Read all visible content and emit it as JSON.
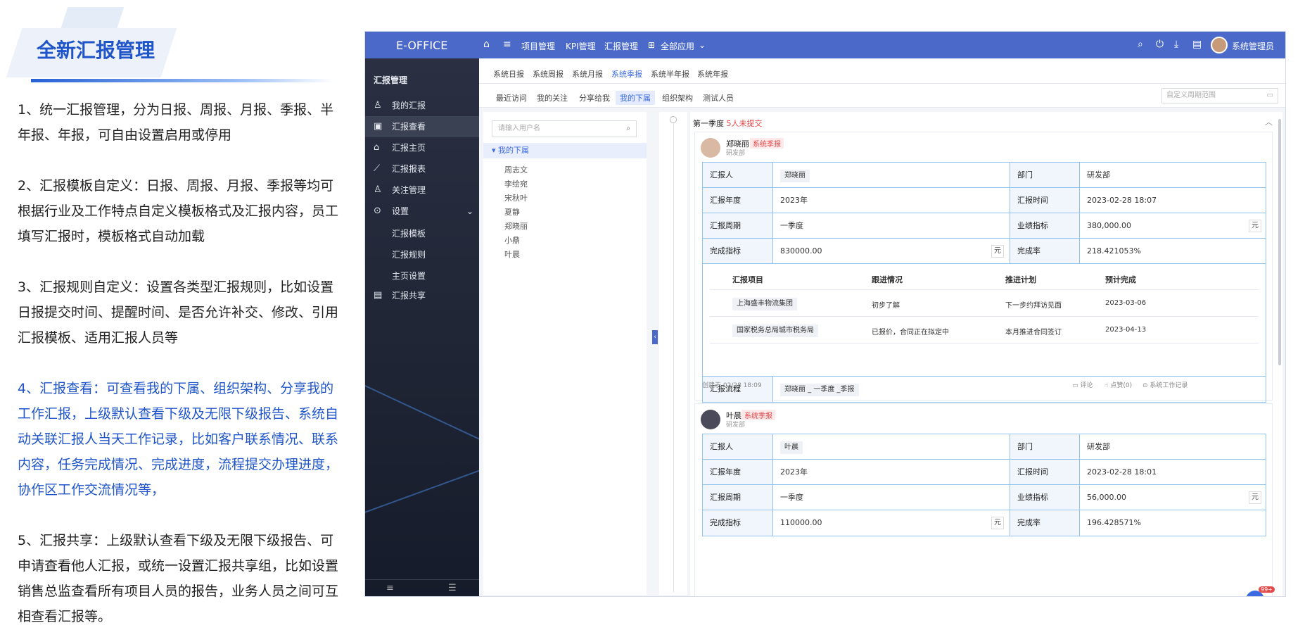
{
  "slide": {
    "title": "全新汇报管理",
    "paragraphs": [
      "1、统一汇报管理，分为日报、周报、月报、季报、半年报、年报，可自由设置启用或停用",
      "2、汇报模板自定义：日报、周报、月报、季报等均可根据行业及工作特点自定义模板格式及汇报内容，员工填写汇报时，模板格式自动加载",
      "3、汇报规则自定义：设置各类型汇报规则，比如设置日报提交时间、提醒时间、是否允许补交、修改、引用汇报模板、适用汇报人员等",
      "4、汇报查看：可查看我的下属、组织架构、分享我的工作汇报，上级默认查看下级及无限下级报告、系统自动关联汇报人当天工作记录，比如客户联系情况、联系内容，任务完成情况、完成进度，流程提交办理进度，协作区工作交流情况等，",
      "5、汇报共享：上级默认查看下级及无限下级报告、可申请查看他人汇报，或统一设置汇报共享组，比如设置销售总监查看所有项目人员的报告，业务人员之间可互相查看汇报等。"
    ]
  },
  "app": {
    "logo": "E-OFFICE",
    "nav": [
      "项目管理",
      "KPI管理",
      "汇报管理",
      "全部应用"
    ],
    "user": "系统管理员",
    "sidebar": {
      "header": "汇报管理",
      "items": [
        "我的汇报",
        "汇报查看",
        "汇报主页",
        "汇报报表",
        "关注管理",
        "设置"
      ],
      "settings_sub": [
        "汇报模板",
        "汇报规则",
        "主页设置"
      ],
      "share": "汇报共享"
    },
    "tabs1": [
      "系统日报",
      "系统周报",
      "系统月报",
      "系统季报",
      "系统半年报",
      "系统年报"
    ],
    "tabs2": [
      "最近访问",
      "我的关注",
      "分享给我",
      "我的下属",
      "组织架构",
      "测试人员"
    ],
    "range_placeholder": "自定义周期范围",
    "search_placeholder": "请输入用户名",
    "tree_root": "我的下属",
    "tree_nodes": [
      "周志文",
      "李绘宛",
      "宋秋叶",
      "夏静",
      "郑晓丽",
      "小鼎",
      "叶晨"
    ],
    "quarter_label": "第一季度",
    "quarter_missing": "5人未提交",
    "card1": {
      "name": "郑晓丽",
      "dept": "研发部",
      "tag": "系统季报",
      "labels": {
        "reporter": "汇报人",
        "dept": "部门",
        "year": "汇报年度",
        "time": "汇报时间",
        "period": "汇报周期",
        "target": "业绩指标",
        "done": "完成指标",
        "rate": "完成率",
        "flow": "汇报流程"
      },
      "reporter": "郑晓丽",
      "dept_val": "研发部",
      "year": "2023年",
      "time": "2023-02-28 18:07",
      "period": "一季度",
      "target": "380,000.00",
      "unit": "元",
      "done": "830000.00",
      "rate": "218.421053%",
      "sub_headers": [
        "汇报项目",
        "跟进情况",
        "推进计划",
        "预计完成"
      ],
      "sub_rows": [
        [
          "上海盛丰物流集团",
          "初步了解",
          "下一步约拜访见面",
          "2023-03-06"
        ],
        [
          "国家税务总局城市税务局",
          "已报价，合同正在拟定中",
          "本月推进合同签订",
          "2023-04-13"
        ]
      ],
      "flow": "郑晓丽 _ 一季度 _季报",
      "created": "创建于 02/28 18:09",
      "actions": [
        "评论",
        "点赞(0)",
        "系统工作记录"
      ]
    },
    "card2": {
      "name": "叶晨",
      "dept": "研发部",
      "tag": "系统季报",
      "reporter": "叶晨",
      "dept_val": "研发部",
      "year": "2023年",
      "time": "2023-02-28 18:01",
      "period": "一季度",
      "target": "56,000.00",
      "done": "110000.00",
      "rate": "196.428571%"
    },
    "fab_badge": "99+"
  }
}
